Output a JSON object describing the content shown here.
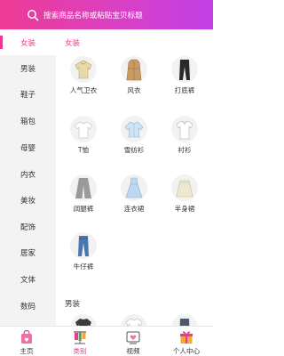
{
  "search": {
    "placeholder": "搜索商品名称或粘贴宝贝标题"
  },
  "sidebar": {
    "items": [
      {
        "label": "女装",
        "active": true
      },
      {
        "label": "男装"
      },
      {
        "label": "鞋子"
      },
      {
        "label": "箱包"
      },
      {
        "label": "母婴"
      },
      {
        "label": "内衣"
      },
      {
        "label": "美妆"
      },
      {
        "label": "配饰"
      },
      {
        "label": "居家"
      },
      {
        "label": "文体"
      },
      {
        "label": "数码"
      }
    ]
  },
  "sections": [
    {
      "title": "女装",
      "items": [
        {
          "label": "人气卫衣",
          "icon": "hoodie-icon"
        },
        {
          "label": "风衣",
          "icon": "trench-coat-icon"
        },
        {
          "label": "打底裤",
          "icon": "leggings-icon"
        },
        {
          "label": "T恤",
          "icon": "tshirt-icon"
        },
        {
          "label": "雪纺衫",
          "icon": "chiffon-shirt-icon"
        },
        {
          "label": "衬衫",
          "icon": "shirt-icon"
        },
        {
          "label": "阔腿裤",
          "icon": "wide-leg-pants-icon"
        },
        {
          "label": "连衣裙",
          "icon": "dress-icon"
        },
        {
          "label": "半身裙",
          "icon": "skirt-icon"
        },
        {
          "label": "牛仔裤",
          "icon": "jeans-icon"
        }
      ]
    },
    {
      "title": "男装",
      "items": []
    }
  ],
  "tabbar": {
    "items": [
      {
        "label": "主页",
        "icon": "shopping-bag-icon"
      },
      {
        "label": "类别",
        "icon": "clothes-rack-icon",
        "active": true
      },
      {
        "label": "视频",
        "icon": "video-icon"
      },
      {
        "label": "个人中心",
        "icon": "gift-icon"
      }
    ]
  },
  "colors": {
    "accent": "#e83a8f",
    "header_start": "#ee3b93",
    "header_end": "#c13fe6"
  }
}
